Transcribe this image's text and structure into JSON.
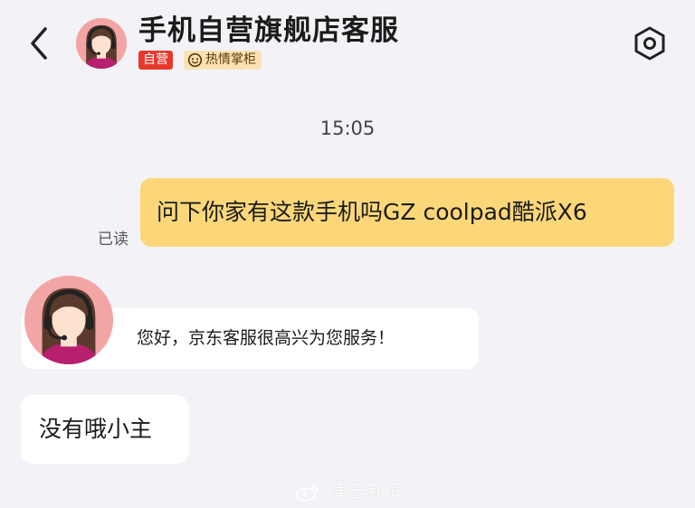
{
  "header": {
    "title": "手机自营旗舰店客服",
    "badges": {
      "self_run": "自营",
      "hot_counter": "热情掌柜"
    },
    "icons": {
      "back": "back-chevron-icon",
      "settings": "settings-hexagon-icon",
      "avatar": "customer-service-avatar"
    }
  },
  "chat": {
    "timestamp": "15:05",
    "messages": [
      {
        "sender": "user",
        "text": "问下你家有这款手机吗GZ coolpad酷派X6",
        "status": "已读"
      },
      {
        "sender": "agent",
        "text": "您好，京东客服很高兴为您服务！"
      },
      {
        "sender": "agent",
        "text": "没有哦小主"
      }
    ]
  },
  "watermark": {
    "text": "津云新闻",
    "icon": "weibo-icon"
  },
  "colors": {
    "self_badge": "#e8382e",
    "hot_badge_bg": "#fbe2b4",
    "user_bubble": "#fbd77a",
    "background": "#f3f3f7",
    "avatar_bg": "#f3a5a5"
  }
}
